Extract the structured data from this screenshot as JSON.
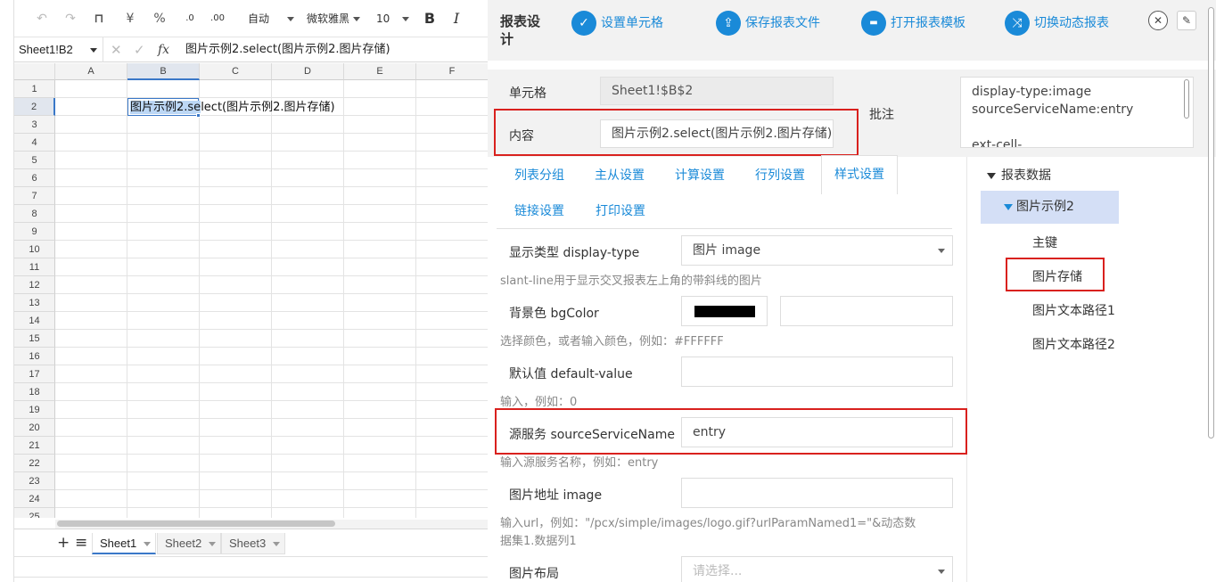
{
  "toolbar": {
    "undo": "↶",
    "redo": "↷",
    "format_painter": "⊓",
    "currency": "¥",
    "percent": "%",
    "decimal_decrease": ".0",
    "decimal_increase": ".00",
    "wrap": "自动",
    "font": "微软雅黑",
    "font_size": "10",
    "bold": "B",
    "italic": "I"
  },
  "formula_bar": {
    "name_box": "Sheet1!B2",
    "cancel": "✕",
    "confirm": "✓",
    "fx": "fx",
    "formula": "图片示例2.select(图片示例2.图片存储)"
  },
  "grid": {
    "columns": [
      "A",
      "B",
      "C",
      "D",
      "E",
      "F"
    ],
    "rows": [
      "1",
      "2",
      "3",
      "4",
      "5",
      "6",
      "7",
      "8",
      "9",
      "10",
      "11",
      "12",
      "13",
      "14",
      "15",
      "16",
      "17",
      "18",
      "19",
      "20",
      "21",
      "22",
      "23",
      "24",
      "25"
    ],
    "selected_cell": "B2",
    "cell_text_highlight": "图片示例2.se",
    "cell_text_rest": "lect(图片示例2.图片存储)"
  },
  "sheet_tabs": {
    "add": "+",
    "menu": "≡",
    "tabs": [
      "Sheet1",
      "Sheet2",
      "Sheet3"
    ],
    "active": "Sheet1"
  },
  "panel": {
    "title": "报表设计",
    "actions": [
      {
        "label": "设置单元格",
        "icon": "check-icon",
        "glyph": "✓"
      },
      {
        "label": "保存报表文件",
        "icon": "upload-icon",
        "glyph": "⇪"
      },
      {
        "label": "打开报表模板",
        "icon": "folder-icon",
        "glyph": "▬"
      },
      {
        "label": "切换动态报表",
        "icon": "shuffle-icon",
        "glyph": "⤨"
      }
    ],
    "close_glyph": "✕",
    "pin_glyph": "✎",
    "cell_label": "单元格",
    "cell_value": "Sheet1!$B$2",
    "content_label": "内容",
    "content_value": "图片示例2.select(图片示例2.图片存储)",
    "note_label": "批注",
    "note_lines": [
      "display-type:image",
      "sourceServiceName:entry",
      "",
      "ext-cell-"
    ],
    "tabs_row1": [
      "列表分组",
      "主从设置",
      "计算设置",
      "行列设置",
      "样式设置"
    ],
    "tabs_row2": [
      "链接设置",
      "打印设置"
    ],
    "active_tab": "样式设置",
    "fields": {
      "display_type_label": "显示类型 display-type",
      "display_type_value": "图片 image",
      "display_type_hint": "slant-line用于显示交叉报表左上角的带斜线的图片",
      "bgcolor_label": "背景色 bgColor",
      "bgcolor_value": "#000000",
      "bgcolor_hint": "选择颜色，或者输入颜色，例如：#FFFFFF",
      "default_label": "默认值 default-value",
      "default_hint": "输入，例如：0",
      "source_label": "源服务 sourceServiceName",
      "source_value": "entry",
      "source_hint": "输入源服务名称，例如：entry",
      "image_label": "图片地址 image",
      "image_hint_1": "输入url，例如：\"/pcx/simple/images/logo.gif?urlParamNamed1=\"&动态数",
      "image_hint_2": "据集1.数据列1",
      "layout_label": "图片布局",
      "layout_placeholder": "请选择..."
    },
    "tree": {
      "root": "报表数据",
      "dataset": "图片示例2",
      "children": [
        "主键",
        "图片存储",
        "图片文本路径1",
        "图片文本路径2"
      ]
    }
  },
  "colors": {
    "accent": "#1a8ad8",
    "highlight_box": "#d9211e",
    "selection": "#3a78c8",
    "tree_selected_bg": "#d4dff6"
  }
}
